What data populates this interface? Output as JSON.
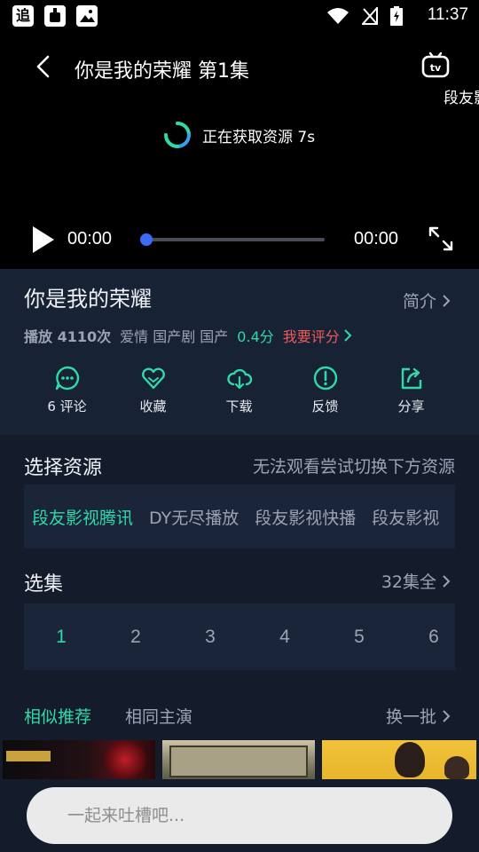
{
  "status_bar": {
    "app_icon_1_text": "追",
    "time": "11:37"
  },
  "player": {
    "title": "你是我的荣耀 第1集",
    "tv_label": "段友影视",
    "loading_text": "正在获取资源 7s",
    "current_time": "00:00",
    "total_time": "00:00",
    "progress": 0
  },
  "info": {
    "show_title": "你是我的荣耀",
    "intro_label": "简介",
    "plays": "播放 4110次",
    "tags": "爱情 国产剧 国产",
    "score": "0.4分",
    "rate_label": "我要评分",
    "actions": [
      {
        "label": "6 评论",
        "icon": "comment-icon"
      },
      {
        "label": "收藏",
        "icon": "heart-icon"
      },
      {
        "label": "下载",
        "icon": "cloud-download-icon"
      },
      {
        "label": "反馈",
        "icon": "feedback-icon"
      },
      {
        "label": "分享",
        "icon": "share-icon"
      }
    ]
  },
  "source": {
    "title": "选择资源",
    "hint": "无法观看尝试切换下方资源",
    "tabs": [
      "段友影视腾讯",
      "DY无尽播放",
      "段友影视快播",
      "段友影视"
    ]
  },
  "episodes": {
    "title": "选集",
    "count_label": "32集全",
    "items": [
      "1",
      "2",
      "3",
      "4",
      "5",
      "6"
    ],
    "active": "1"
  },
  "recommendations": {
    "tab_similar": "相似推荐",
    "tab_same_cast": "相同主演",
    "refresh_label": "换一批"
  },
  "comment": {
    "placeholder": "一起来吐槽吧..."
  },
  "colors": {
    "accent": "#2fd9a8",
    "rate": "#f25a5a",
    "seek_knob": "#3b6cf6",
    "panel": "#182235",
    "background": "#141c2b"
  }
}
